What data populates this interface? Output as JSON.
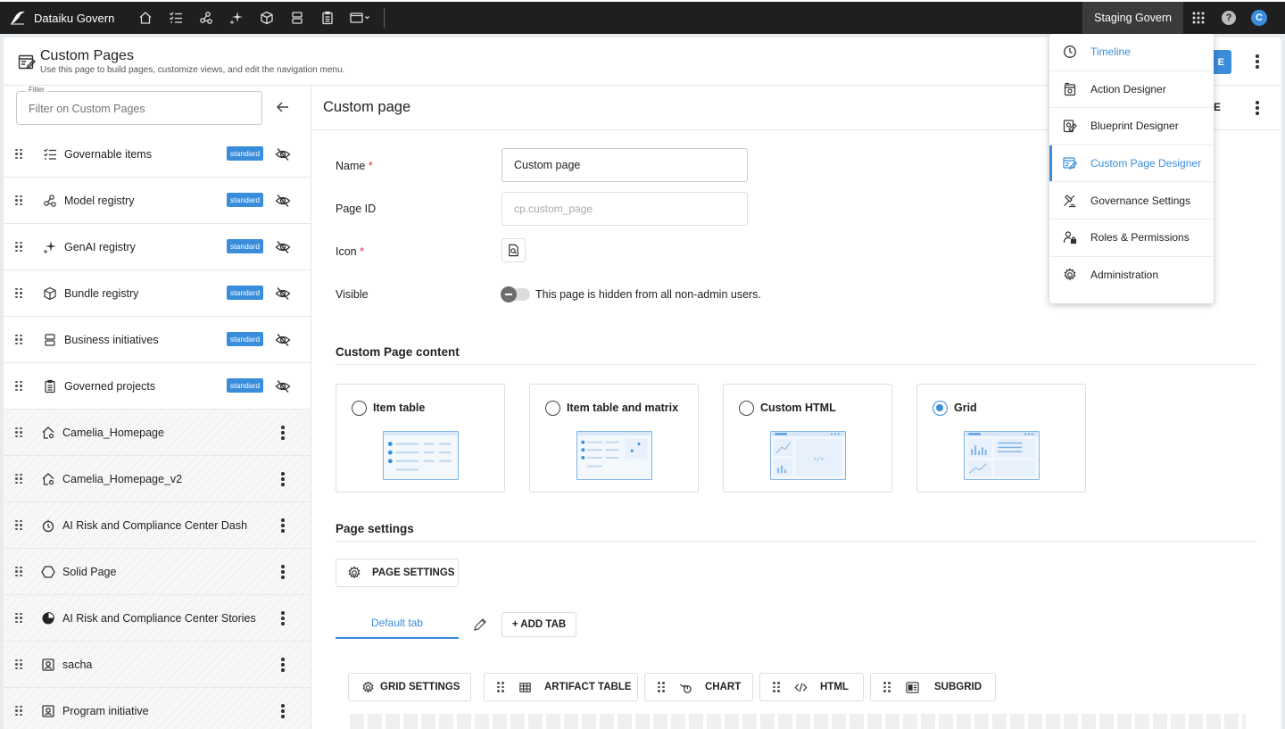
{
  "app": {
    "name": "Dataiku Govern",
    "environment": "Staging Govern",
    "avatar_initial": "C"
  },
  "nav_icons": [
    "home-icon",
    "governable-items-icon",
    "model-registry-icon",
    "genai-registry-icon",
    "bundle-registry-icon",
    "business-initiatives-icon",
    "governed-projects-icon",
    "custom-pages-dropdown-icon"
  ],
  "page": {
    "title": "Custom Pages",
    "subtitle": "Use this page to build pages, customize views, and edit the navigation menu.",
    "primary_button_tail": "E"
  },
  "filter": {
    "label": "Filter",
    "placeholder": "Filter on Custom Pages"
  },
  "left_items": [
    {
      "label": "Governable items",
      "badge": "standard",
      "icon": "checklist-icon",
      "type": "standard"
    },
    {
      "label": "Model registry",
      "badge": "standard",
      "icon": "model-registry-icon",
      "type": "standard"
    },
    {
      "label": "GenAI registry",
      "badge": "standard",
      "icon": "sparkle-icon",
      "type": "standard"
    },
    {
      "label": "Bundle registry",
      "badge": "standard",
      "icon": "cube-icon",
      "type": "standard"
    },
    {
      "label": "Business initiatives",
      "badge": "standard",
      "icon": "stack-icon",
      "type": "standard"
    },
    {
      "label": "Governed projects",
      "badge": "standard",
      "icon": "clipboard-icon",
      "type": "standard"
    },
    {
      "label": "Camelia_Homepage",
      "icon": "home-gear-icon",
      "type": "custom"
    },
    {
      "label": "Camelia_Homepage_v2",
      "icon": "home-gear-icon",
      "type": "custom"
    },
    {
      "label": "AI Risk and Compliance Center Dash",
      "icon": "timer-icon",
      "type": "custom"
    },
    {
      "label": "Solid Page",
      "icon": "hexagon-icon",
      "type": "custom"
    },
    {
      "label": "AI Risk and Compliance Center Stories",
      "icon": "pie-icon",
      "type": "custom"
    },
    {
      "label": "sacha",
      "icon": "portrait-icon",
      "type": "custom"
    },
    {
      "label": "Program initiative",
      "icon": "portrait-icon",
      "type": "custom"
    }
  ],
  "form": {
    "header": "Custom page",
    "header_button_tail": "E",
    "name_label": "Name",
    "name_value": "Custom page",
    "page_id_label": "Page ID",
    "page_id_placeholder": "cp.custom_page",
    "icon_label": "Icon",
    "visible_label": "Visible",
    "visible_text": "This page is hidden from all non-admin users.",
    "required_mark": "*"
  },
  "content_section": {
    "title": "Custom Page content",
    "options": [
      {
        "label": "Item table",
        "selected": false
      },
      {
        "label": "Item table and matrix",
        "selected": false
      },
      {
        "label": "Custom HTML",
        "selected": false
      },
      {
        "label": "Grid",
        "selected": true
      }
    ]
  },
  "settings_section": {
    "title": "Page settings",
    "page_settings_button": "PAGE SETTINGS",
    "tab_label": "Default tab",
    "add_tab": "+ ADD TAB"
  },
  "grid_tools": [
    {
      "label": "GRID SETTINGS",
      "icon": "gear-icon"
    },
    {
      "label": "ARTIFACT TABLE",
      "icon": "table-icon"
    },
    {
      "label": "CHART",
      "icon": "chart-icon"
    },
    {
      "label": "HTML",
      "icon": "code-icon"
    },
    {
      "label": "SUBGRID",
      "icon": "subgrid-icon"
    }
  ],
  "dropdown_menu": [
    {
      "label": "Timeline",
      "icon": "clock-icon",
      "state": "highlighted"
    },
    {
      "label": "Action Designer",
      "icon": "action-designer-icon",
      "state": "normal"
    },
    {
      "label": "Blueprint Designer",
      "icon": "blueprint-designer-icon",
      "state": "normal"
    },
    {
      "label": "Custom Page Designer",
      "icon": "custom-page-designer-icon",
      "state": "active"
    },
    {
      "label": "Governance Settings",
      "icon": "gavel-icon",
      "state": "normal"
    },
    {
      "label": "Roles & Permissions",
      "icon": "lock-person-icon",
      "state": "normal"
    },
    {
      "label": "Administration",
      "icon": "gear-icon",
      "state": "normal"
    }
  ],
  "colors": {
    "accent": "#3a8ddb",
    "topbar": "#1f1f1f",
    "required": "#d9303e"
  }
}
